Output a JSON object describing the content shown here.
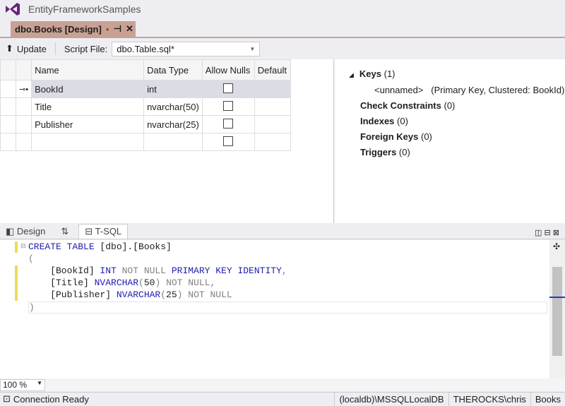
{
  "app": {
    "title": "EntityFrameworkSamples"
  },
  "tab": {
    "label": "dbo.Books [Design]",
    "dot": "●",
    "pin": "⊣",
    "close": "✕"
  },
  "toolbar": {
    "update_label": "Update",
    "script_file_label": "Script File:",
    "script_file_value": "dbo.Table.sql*"
  },
  "grid": {
    "headers": [
      "Name",
      "Data Type",
      "Allow Nulls",
      "Default"
    ],
    "rows": [
      {
        "name": "BookId",
        "type": "int",
        "allow_nulls": false,
        "key": true
      },
      {
        "name": "Title",
        "type": "nvarchar(50)",
        "allow_nulls": false
      },
      {
        "name": "Publisher",
        "type": "nvarchar(25)",
        "allow_nulls": false
      },
      {
        "name": "",
        "type": "",
        "allow_nulls": false
      }
    ]
  },
  "properties": {
    "keys_label": "Keys",
    "keys_count": "(1)",
    "key_item_name": "<unnamed>",
    "key_item_desc": "(Primary Key, Clustered: BookId)",
    "items": [
      {
        "label": "Check Constraints",
        "count": "(0)"
      },
      {
        "label": "Indexes",
        "count": "(0)"
      },
      {
        "label": "Foreign Keys",
        "count": "(0)"
      },
      {
        "label": "Triggers",
        "count": "(0)"
      }
    ]
  },
  "bottom_tabs": {
    "design": "Design",
    "swap": "⇅",
    "tsql": "T-SQL"
  },
  "code": {
    "l1a": "CREATE TABLE ",
    "l1b": "[dbo].[Books]",
    "l2": "(",
    "l3a": "    [BookId] ",
    "l3b": "INT",
    "l3c": " NOT NULL ",
    "l3d": "PRIMARY KEY IDENTITY",
    ",": ",",
    "l4a": "    [Title] ",
    "l4b": "NVARCHAR",
    "l4c": "(",
    "l4d": "50",
    "l4e": ")",
    "l4f": " NOT NULL,",
    "l5a": "    [Publisher] ",
    "l5b": "NVARCHAR",
    "l5c": "(",
    "l5d": "25",
    "l5e": ")",
    "l5f": " NOT NULL",
    "l6": ")"
  },
  "zoom": "100 %",
  "status": {
    "left": "Connection Ready",
    "server": "(localdb)\\MSSQLLocalDB",
    "user": "THEROCKS\\chris",
    "db": "Books"
  }
}
